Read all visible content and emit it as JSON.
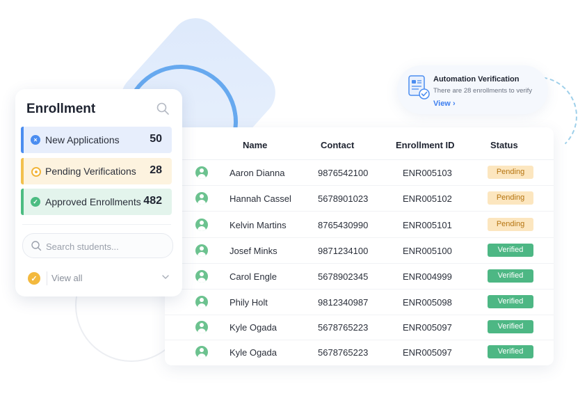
{
  "enrollment": {
    "title": "Enrollment",
    "stats": [
      {
        "label": "New Applications",
        "count": "50"
      },
      {
        "label": "Pending Verifications",
        "count": "28"
      },
      {
        "label": "Approved Enrollments",
        "count": "482"
      }
    ],
    "search": {
      "placeholder": "Search students..."
    },
    "view_all_label": "View all"
  },
  "automation": {
    "title": "Automation Verification",
    "description": "There are 28 enrollments to verify",
    "link_label": "View"
  },
  "table": {
    "headers": {
      "name": "Name",
      "contact": "Contact",
      "enrollment_id": "Enrollment ID",
      "status": "Status"
    },
    "rows": [
      {
        "name": "Aaron Dianna",
        "contact": "9876542100",
        "id": "ENR005103",
        "status": "Pending"
      },
      {
        "name": "Hannah Cassel",
        "contact": "5678901023",
        "id": "ENR005102",
        "status": "Pending"
      },
      {
        "name": "Kelvin Martins",
        "contact": "8765430990",
        "id": "ENR005101",
        "status": "Pending"
      },
      {
        "name": "Josef Minks",
        "contact": "9871234100",
        "id": "ENR005100",
        "status": "Verified"
      },
      {
        "name": "Carol Engle",
        "contact": "5678902345",
        "id": "ENR004999",
        "status": "Verified"
      },
      {
        "name": "Phily Holt",
        "contact": "9812340987",
        "id": "ENR005098",
        "status": "Verified"
      },
      {
        "name": "Kyle Ogada",
        "contact": "5678765223",
        "id": "ENR005097",
        "status": "Verified"
      },
      {
        "name": "Kyle Ogada",
        "contact": "5678765223",
        "id": "ENR005097",
        "status": "Verified"
      }
    ]
  },
  "colors": {
    "accent_blue": "#4b8df0",
    "pending_yellow": "#f2c04d",
    "verified_green": "#4db784"
  }
}
